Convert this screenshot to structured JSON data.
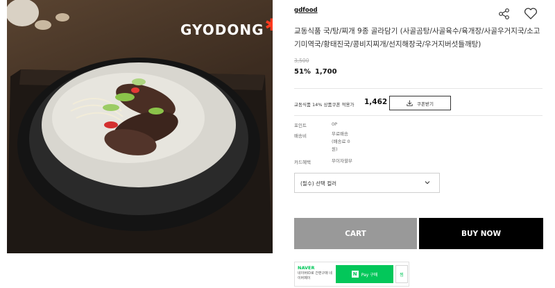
{
  "image": {
    "brand_logo": "GYODONG",
    "alt": "product-photo"
  },
  "product": {
    "seller": "gdfood",
    "title": "교동식품 국/탕/찌개 9종 골라담기 (사골곰탕/사골육수/육개장/사골우거지국/소고기미역국/황태진국/콩비지찌개/선지해장국/우거지버섯들깨탕)",
    "original_price": "3,500",
    "discount": "51%",
    "sale_price": "1,700"
  },
  "coupon": {
    "label": "교동식품 14% 상품쿠폰 적용가",
    "price": "1,462",
    "button_label": "쿠폰받기"
  },
  "meta": {
    "points_label": "포인트",
    "points_value": "0P",
    "shipping_label": "배송비",
    "shipping_value": "무료배송\n(배송료 0\n원)",
    "card_label": "카드혜택",
    "card_value": "무이자할부"
  },
  "option": {
    "placeholder": "(필수) 선택 컬러"
  },
  "actions": {
    "cart_label": "CART",
    "buy_label": "BUY NOW"
  },
  "naver": {
    "logo": "NAVER",
    "desc": "네이버ID로 간편구매 네이버페이",
    "pay_label": "Pay 구매",
    "n_badge": "N",
    "wish_label": "찜"
  },
  "colors": {
    "cart_bg": "#999999",
    "buy_bg": "#000000",
    "naver_green": "#03c75a",
    "logo_star": "#ff3b1f"
  },
  "icons": [
    "share-icon",
    "heart-icon",
    "download-icon",
    "chevron-down-icon"
  ]
}
